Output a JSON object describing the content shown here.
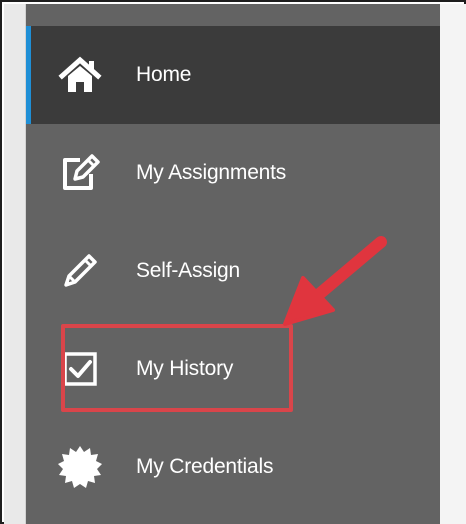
{
  "sidebar": {
    "items": [
      {
        "id": "home",
        "label": "Home",
        "icon": "home-icon",
        "active": true
      },
      {
        "id": "my-assignments",
        "label": "My Assignments",
        "icon": "edit-icon",
        "active": false
      },
      {
        "id": "self-assign",
        "label": "Self-Assign",
        "icon": "pencil-icon",
        "active": false
      },
      {
        "id": "my-history",
        "label": "My History",
        "icon": "checkbox-icon",
        "active": false,
        "highlighted": true
      },
      {
        "id": "my-credentials",
        "label": "My Credentials",
        "icon": "badge-seal-icon",
        "active": false
      }
    ]
  },
  "annotation": {
    "highlight_color": "#d9454a",
    "arrow_color": "#e0353e",
    "target": "my-history"
  },
  "colors": {
    "sidebar_bg": "#636363",
    "active_bg": "#3b3b3b",
    "active_indicator": "#1f8fd6",
    "text": "#ffffff"
  }
}
